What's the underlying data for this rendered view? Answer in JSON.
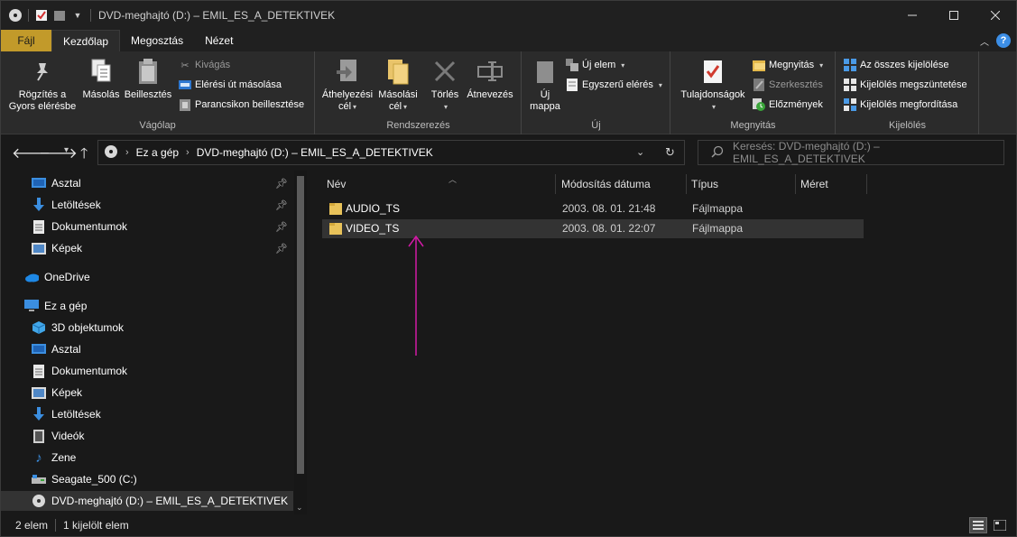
{
  "window": {
    "title": "DVD-meghajtó (D:) – EMIL_ES_A_DETEKTIVEK",
    "controls": [
      "minimize",
      "maximize",
      "close"
    ]
  },
  "ribbon_tabs": [
    "Fájl",
    "Kezdőlap",
    "Megosztás",
    "Nézet"
  ],
  "ribbon": {
    "clipboard": {
      "label": "Vágólap",
      "pin": "Rögzítés a\nGyors elérésbe",
      "pin_1": "Rögzítés a",
      "pin_2": "Gyors elérésbe",
      "copy": "Másolás",
      "paste": "Beillesztés",
      "cut": "Kivágás",
      "copy_path": "Elérési út másolása",
      "paste_shortcut": "Parancsikon beillesztése"
    },
    "organize": {
      "label": "Rendszerezés",
      "move_1": "Áthelyezési",
      "move_2": "cél",
      "copyto_1": "Másolási",
      "copyto_2": "cél",
      "delete": "Törlés",
      "rename": "Átnevezés"
    },
    "new": {
      "label": "Új",
      "new_folder_1": "Új",
      "new_folder_2": "mappa",
      "new_item": "Új elem",
      "easy_access": "Egyszerű elérés"
    },
    "open": {
      "label": "Megnyitás",
      "properties": "Tulajdonságok",
      "open": "Megnyitás",
      "edit": "Szerkesztés",
      "history": "Előzmények"
    },
    "select": {
      "label": "Kijelölés",
      "select_all": "Az összes kijelölése",
      "select_none": "Kijelölés megszüntetése",
      "invert": "Kijelölés megfordítása"
    }
  },
  "address": {
    "crumbs": [
      "Ez a gép",
      "DVD-meghajtó (D:) – EMIL_ES_A_DETEKTIVEK"
    ],
    "search_placeholder": "Keresés: DVD-meghajtó (D:) – EMIL_ES_A_DETEKTIVEK"
  },
  "nav": {
    "quick": [
      {
        "label": "Asztal",
        "icon": "desktop-icon",
        "pinned": true
      },
      {
        "label": "Letöltések",
        "icon": "download-icon",
        "pinned": true
      },
      {
        "label": "Dokumentumok",
        "icon": "document-icon",
        "pinned": true
      },
      {
        "label": "Képek",
        "icon": "pictures-icon",
        "pinned": true
      }
    ],
    "onedrive": "OneDrive",
    "this_pc": "Ez a gép",
    "pc_items": [
      {
        "label": "3D objektumok",
        "icon": "cube-icon"
      },
      {
        "label": "Asztal",
        "icon": "desktop-icon"
      },
      {
        "label": "Dokumentumok",
        "icon": "document-icon"
      },
      {
        "label": "Képek",
        "icon": "pictures-icon"
      },
      {
        "label": "Letöltések",
        "icon": "download-icon"
      },
      {
        "label": "Videók",
        "icon": "video-icon"
      },
      {
        "label": "Zene",
        "icon": "music-icon"
      },
      {
        "label": "Seagate_500 (C:)",
        "icon": "drive-icon"
      },
      {
        "label": "DVD-meghajtó (D:) – EMIL_ES_A_DETEKTIVEK",
        "icon": "dvd-icon",
        "selected": true
      }
    ]
  },
  "columns": [
    "Név",
    "Módosítás dátuma",
    "Típus",
    "Méret"
  ],
  "files": [
    {
      "name": "AUDIO_TS",
      "date": "2003. 08. 01. 21:48",
      "type": "Fájlmappa",
      "size": "",
      "selected": false
    },
    {
      "name": "VIDEO_TS",
      "date": "2003. 08. 01. 22:07",
      "type": "Fájlmappa",
      "size": "",
      "selected": true
    }
  ],
  "status": {
    "count": "2 elem",
    "selected": "1 kijelölt elem"
  },
  "colors": {
    "accent_file_tab": "#c29a2a",
    "annotation_arrow": "#d21aa6",
    "folder": "#e8c25a"
  }
}
